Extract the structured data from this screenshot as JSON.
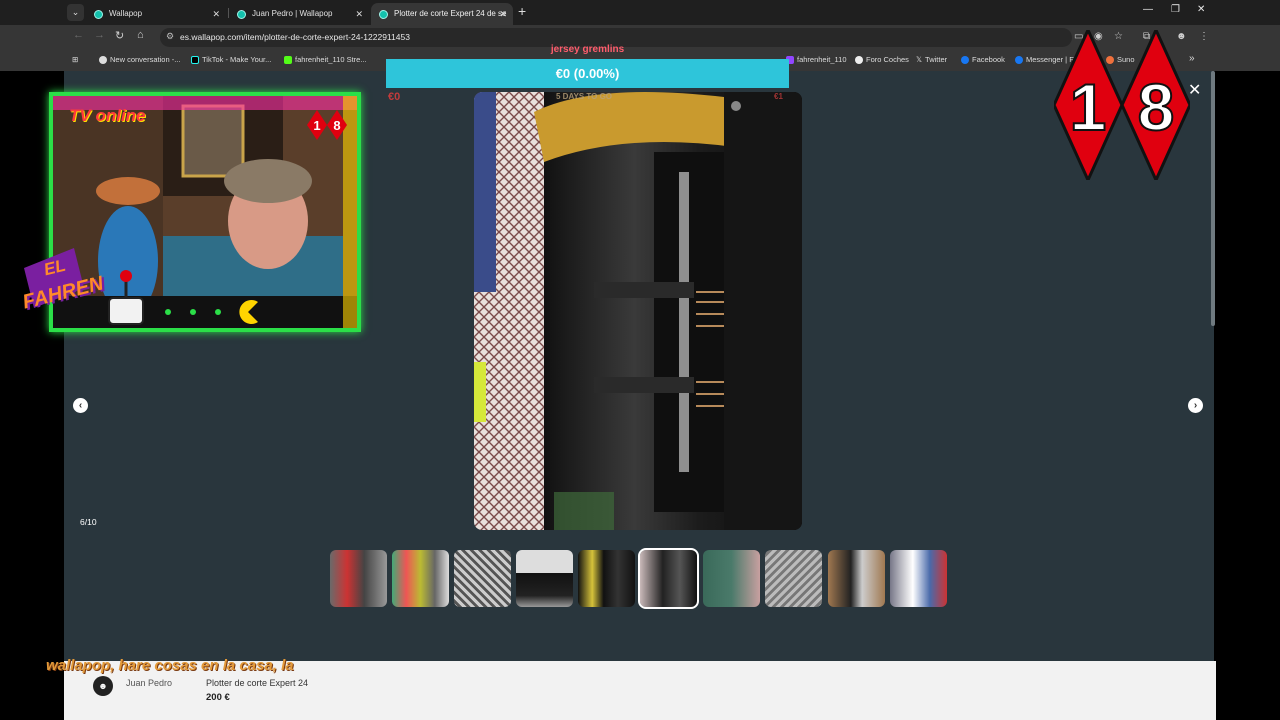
{
  "browser": {
    "tabs": [
      {
        "label": "Wallapop",
        "active": false
      },
      {
        "label": "Juan Pedro | Wallapop",
        "active": false
      },
      {
        "label": "Plotter de corte Expert 24 de se",
        "active": true
      }
    ],
    "url": "es.wallapop.com/item/plotter-de-corte-expert-24-1222911453",
    "bookmarks": [
      "New conversation -...",
      "TikTok - Make Your...",
      "fahrenheit_110 Stre...",
      "fahrenheit_110",
      "Foro Coches",
      "Twitter",
      "Facebook",
      "Messenger | Fa",
      "Suno"
    ]
  },
  "viewer": {
    "counter": "6/10",
    "thumbnail_count": 10,
    "current_index": 6
  },
  "listing": {
    "seller_name": "Juan Pedro",
    "product_title": "Plotter de corte Expert 24",
    "price": "200 €"
  },
  "overlay": {
    "donation_name": "jersey gremlins",
    "donation_bar": "€0 (0.00%)",
    "small_amount_left": "€0",
    "small_goal_text": "5 DAYS TO GO",
    "small_amount_right": "€1",
    "webcam_title": "TV online",
    "webcam_badge": "18",
    "logo_line1": "EL",
    "logo_line2": "FAHREN",
    "rating_left": "1",
    "rating_right": "8",
    "ticker": "wallapop, hare cosas en la casa, la"
  },
  "colors": {
    "viewer_bg": "#29363d",
    "wallapop_teal": "#13c1ac",
    "donation_bar": "#2ec5da",
    "rating_red": "#e0000f",
    "webcam_border": "#2bdf48"
  }
}
